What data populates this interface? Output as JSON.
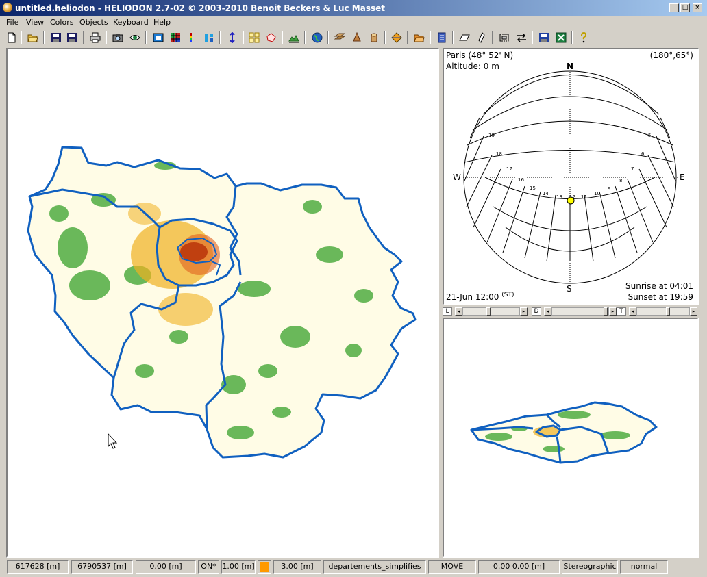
{
  "window": {
    "title": "untitled.heliodon  -  HELIODON 2.7-02 © 2003-2010 Benoit Beckers & Luc Masset",
    "minimize": "_",
    "maximize": "□",
    "close": "×"
  },
  "menu": [
    "File",
    "View",
    "Colors",
    "Objects",
    "Keyboard",
    "Help"
  ],
  "toolbar": [
    "new-file-icon",
    "open-folder-icon",
    "save-icon",
    "save-as-icon",
    "print-icon",
    "camera-icon",
    "eye-icon",
    "frame-icon",
    "grid-colors-icon",
    "color-scale-icon",
    "tiles-icon",
    "swap-vertical-icon",
    "grid-layout-icon",
    "polygon-select-icon",
    "terrain-chart-icon",
    "globe-icon",
    "layers-icon",
    "cone-icon",
    "cylinder-icon",
    "diamond-icon",
    "open-folder-orange-icon",
    "document-blue-icon",
    "parallelogram-icon",
    "slanted-shape-icon",
    "cut-icon",
    "exchange-arrows-icon",
    "save-disk-icon",
    "excel-icon",
    "help-icon"
  ],
  "sunpath": {
    "location": "Paris (48° 52' N)",
    "view_angles": "(180°,65°)",
    "altitude": "Altitude: 0 m",
    "north": "N",
    "south": "S",
    "east": "E",
    "west": "W",
    "date_time": "21-Jun 12:00",
    "time_mode": "(ST)",
    "sunrise": "Sunrise at 04:01",
    "sunset": "Sunset at 19:59",
    "hours": [
      "5",
      "6",
      "7",
      "8",
      "9",
      "10",
      "11",
      "12",
      "13",
      "14",
      "15",
      "16",
      "17",
      "18",
      "19"
    ]
  },
  "sliders": {
    "l_label": "L",
    "l_value": 0.45,
    "d_label": "D",
    "d_value": 0.97,
    "t_label": "T",
    "t_value": 0.6
  },
  "status": {
    "x_coord": "617628 [m]",
    "y_coord": "6790537 [m]",
    "z_coord": "0.00 [m]",
    "snap": "ON*",
    "grid_step": "1.00 [m]",
    "color_accent": "#ff9900",
    "height": "3.00 [m]",
    "layer": "departements_simplifies",
    "mode": "MOVE",
    "offset": "0.00     0.00 [m]",
    "projection": "Stereographic",
    "render": "normal"
  }
}
